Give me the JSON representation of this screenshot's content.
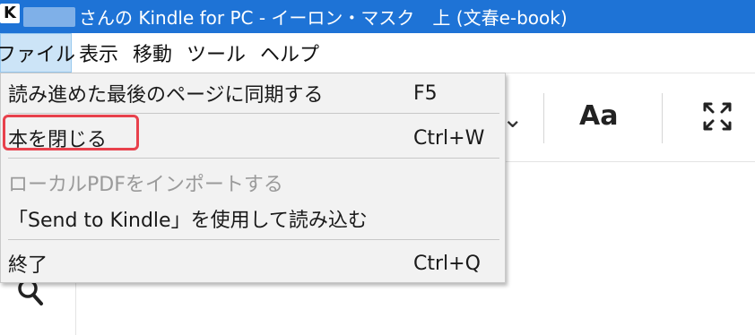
{
  "window": {
    "title": "さんの Kindle for PC - イーロン・マスク　上 (文春e-book)",
    "app_icon_glyph": "K",
    "accent_color": "#1e73d6"
  },
  "menubar": {
    "items": [
      {
        "label": "ファイル",
        "active": true
      },
      {
        "label": "表示"
      },
      {
        "label": "移動"
      },
      {
        "label": "ツール"
      },
      {
        "label": "ヘルプ"
      }
    ]
  },
  "toolbar": {
    "chevron_glyph": "⌄",
    "font_button_label": "Aa",
    "fullscreen_icon": "fullscreen-icon"
  },
  "rail": {
    "search_icon": "search-icon"
  },
  "file_menu": {
    "items": [
      {
        "label": "読み進めた最後のページに同期する",
        "shortcut": "F5",
        "enabled": true
      },
      {
        "label": "本を閉じる",
        "shortcut": "Ctrl+W",
        "enabled": true,
        "highlighted": true
      },
      {
        "label": "ローカルPDFをインポートする",
        "shortcut": "",
        "enabled": false
      },
      {
        "label": "「Send to Kindle」を使用して読み込む",
        "shortcut": "",
        "enabled": true
      },
      {
        "label": "終了",
        "shortcut": "Ctrl+Q",
        "enabled": true
      }
    ],
    "highlight_color": "#e8414c"
  }
}
